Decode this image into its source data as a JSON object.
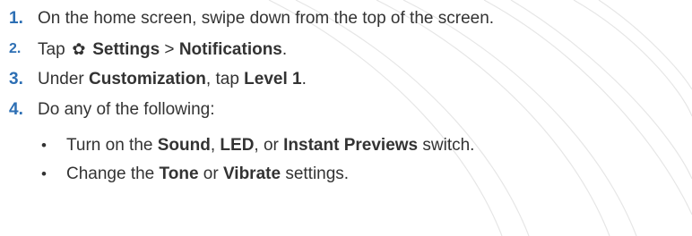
{
  "steps": [
    {
      "num": "1.",
      "parts": [
        "On the home screen, swipe down from the top of the screen."
      ]
    },
    {
      "num": "2.",
      "pre": "Tap ",
      "icon": "settings-gear-icon",
      "b1": "Settings",
      "mid": " > ",
      "b2": "Notifications",
      "post": "."
    },
    {
      "num": "3.",
      "pre": "Under ",
      "b1": "Customization",
      "mid": ", tap ",
      "b2": "Level 1",
      "post": "."
    },
    {
      "num": "4.",
      "parts": [
        "Do any of the following:"
      ]
    }
  ],
  "bullets": [
    {
      "pre": "Turn on the ",
      "b1": "Sound",
      "sep1": ", ",
      "b2": "LED",
      "sep2": ", or ",
      "b3": "Instant Previews",
      "post": " switch."
    },
    {
      "pre": "Change the ",
      "b1": "Tone",
      "sep1": " or ",
      "b2": "Vibrate",
      "post": " settings."
    }
  ],
  "bullet_glyph": "•",
  "gear_glyph": "✿"
}
